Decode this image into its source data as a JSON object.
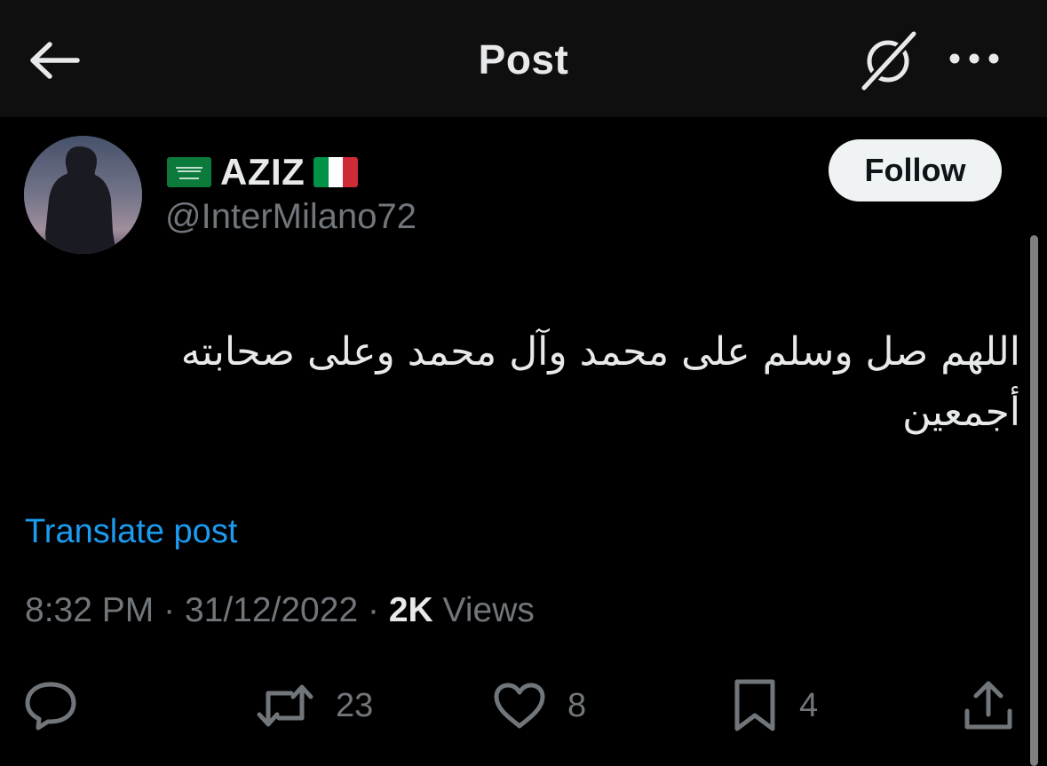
{
  "header": {
    "title": "Post",
    "back_icon": "arrow-left-icon",
    "grok_icon": "grok-icon",
    "more_icon": "more-horizontal-icon"
  },
  "author": {
    "display_name": "AZIZ",
    "handle": "@InterMilano72",
    "flags": [
      "saudi-arabia-flag",
      "italy-flag"
    ],
    "follow_label": "Follow"
  },
  "post": {
    "text": "اللهم صل وسلم على محمد وآل محمد وعلى صحابته أجمعين",
    "translate_label": "Translate post",
    "time": "8:32 PM",
    "separator": "·",
    "date": "31/12/2022",
    "views_count": "2K",
    "views_label": "Views"
  },
  "actions": {
    "reply": {
      "icon": "reply-icon",
      "count": ""
    },
    "repost": {
      "icon": "repost-icon",
      "count": "23"
    },
    "like": {
      "icon": "heart-icon",
      "count": "8"
    },
    "bookmark": {
      "icon": "bookmark-icon",
      "count": "4"
    },
    "share": {
      "icon": "share-icon",
      "count": ""
    }
  },
  "colors": {
    "background": "#000000",
    "header_background": "#0f0f10",
    "text_primary": "#e7e9ea",
    "text_secondary": "#71767b",
    "link": "#1d9bf0",
    "follow_button_bg": "#eff3f4"
  }
}
